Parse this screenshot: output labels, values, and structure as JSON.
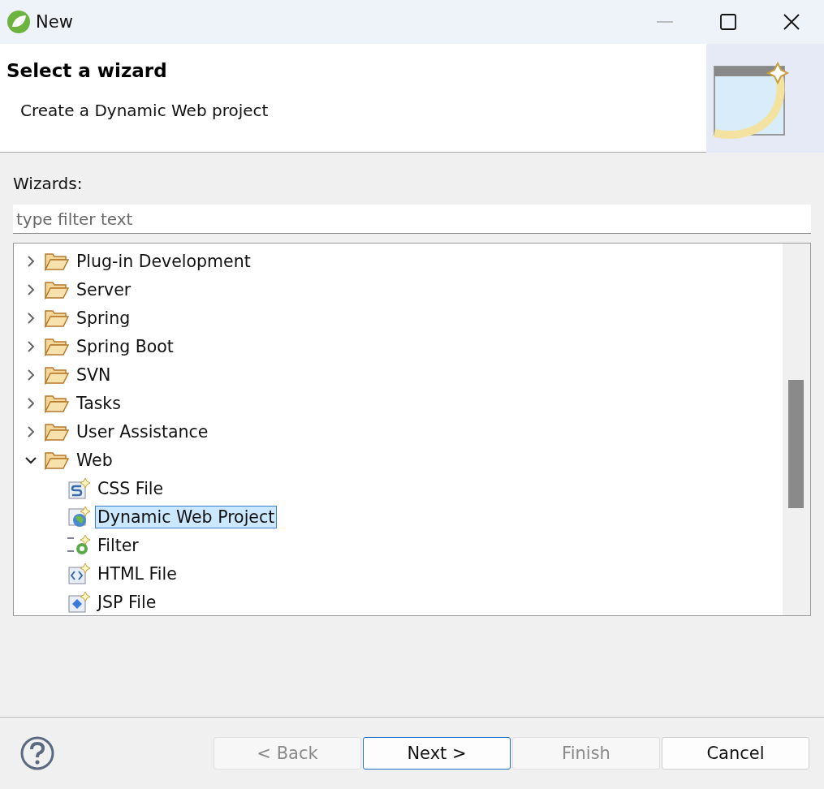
{
  "window": {
    "title": "New"
  },
  "header": {
    "title": "Select a wizard",
    "description": "Create a Dynamic Web project"
  },
  "wizards_label": "Wizards:",
  "filter": {
    "placeholder": "type filter text"
  },
  "tree": [
    {
      "label": "Plug-in Development",
      "kind": "folder",
      "expanded": false,
      "selected": false
    },
    {
      "label": "Server",
      "kind": "folder",
      "expanded": false,
      "selected": false
    },
    {
      "label": "Spring",
      "kind": "folder",
      "expanded": false,
      "selected": false
    },
    {
      "label": "Spring Boot",
      "kind": "folder",
      "expanded": false,
      "selected": false
    },
    {
      "label": "SVN",
      "kind": "folder",
      "expanded": false,
      "selected": false
    },
    {
      "label": "Tasks",
      "kind": "folder",
      "expanded": false,
      "selected": false
    },
    {
      "label": "User Assistance",
      "kind": "folder",
      "expanded": false,
      "selected": false
    },
    {
      "label": "Web",
      "kind": "folder",
      "expanded": true,
      "selected": false,
      "children": [
        {
          "label": "CSS File",
          "kind": "css",
          "selected": false
        },
        {
          "label": "Dynamic Web Project",
          "kind": "project",
          "selected": true
        },
        {
          "label": "Filter",
          "kind": "filter",
          "selected": false
        },
        {
          "label": "HTML File",
          "kind": "html",
          "selected": false
        },
        {
          "label": "JSP File",
          "kind": "jsp",
          "selected": false
        }
      ]
    }
  ],
  "buttons": [
    {
      "label": "< Back",
      "disabled": true,
      "default": false
    },
    {
      "label": "Next >",
      "disabled": false,
      "default": true
    },
    {
      "label": "Finish",
      "disabled": true,
      "default": false
    },
    {
      "label": "Cancel",
      "disabled": false,
      "default": false
    }
  ]
}
